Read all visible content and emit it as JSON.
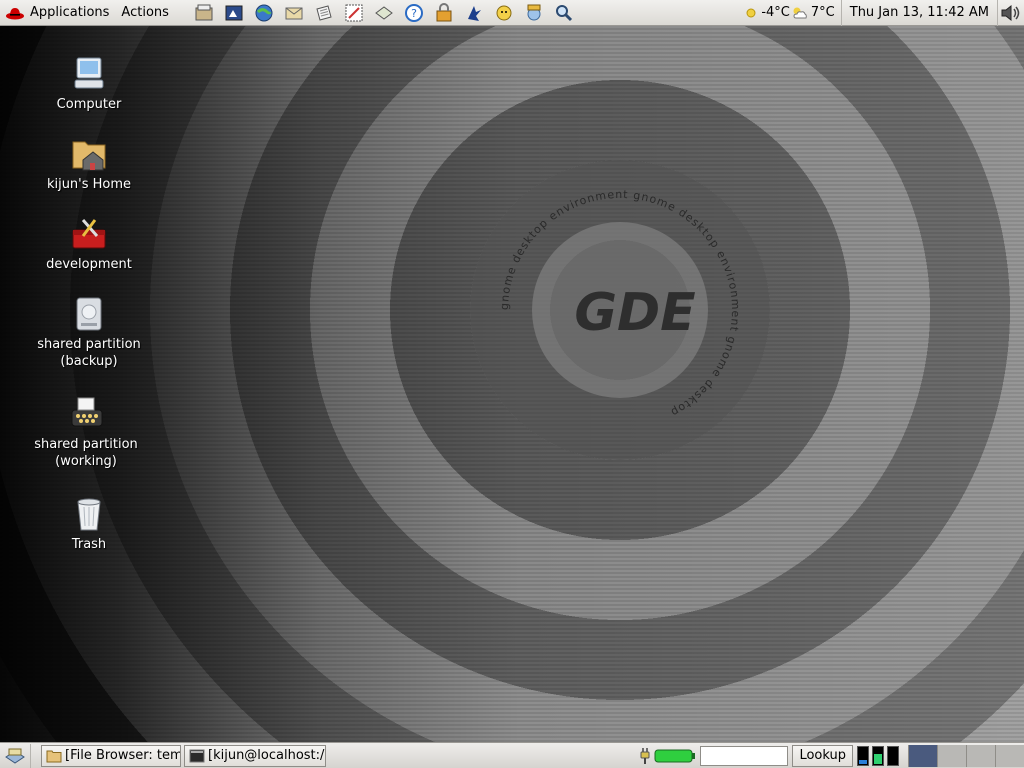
{
  "top_panel": {
    "applications_label": "Applications",
    "actions_label": "Actions",
    "launchers": [
      "archive-icon",
      "presentation-icon",
      "web-browser-icon",
      "email-icon",
      "text-editor-icon",
      "drawing-icon",
      "notes-icon",
      "help-icon",
      "lock-icon",
      "gnome-foot-icon",
      "instant-messenger-icon",
      "network-icon",
      "search-icon"
    ],
    "weather": [
      {
        "icon": "sun-icon",
        "temp": "-4°C"
      },
      {
        "icon": "partly-cloudy-icon",
        "temp": "7°C"
      }
    ],
    "clock": "Thu Jan 13, 11:42 AM"
  },
  "desktop": {
    "icons": [
      {
        "name": "computer",
        "label": "Computer"
      },
      {
        "name": "home",
        "label": "kijun's Home"
      },
      {
        "name": "development",
        "label": "development"
      },
      {
        "name": "shared-backup",
        "label_line1": "shared partition",
        "label_line2": "(backup)"
      },
      {
        "name": "shared-working",
        "label_line1": "shared partition",
        "label_line2": "(working)"
      },
      {
        "name": "trash",
        "label": "Trash"
      }
    ],
    "wallpaper": {
      "logo_text": "GDE",
      "ring_text": "gnome desktop environment gnome desktop environment gnome desktop"
    }
  },
  "bottom_panel": {
    "tasks": [
      {
        "label": "[File Browser: temp]"
      },
      {
        "label": "[kijun@localhost:/hc"
      }
    ],
    "lookup_label": "Lookup",
    "battery_color": "#2fcf3f"
  },
  "colors": {
    "panel_bg": "#dcdad5",
    "active_workspace": "#4a5a7e"
  }
}
